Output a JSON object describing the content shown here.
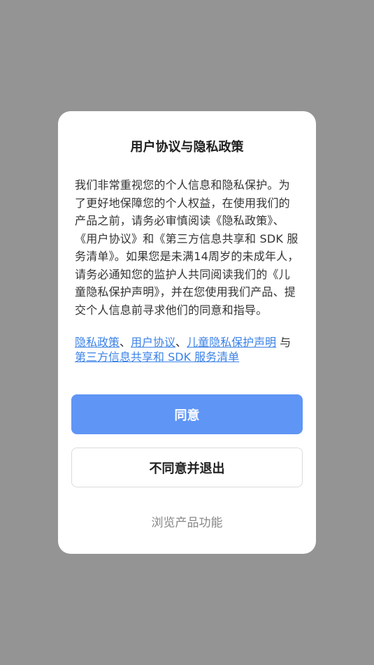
{
  "dialog": {
    "title": "用户协议与隐私政策",
    "body": "我们非常重视您的个人信息和隐私保护。为了更好地保障您的个人权益，在使用我们的产品之前，请务必审慎阅读《隐私政策》、《用户协议》和《第三方信息共享和 SDK 服务清单》。如果您是未满14周岁的未成年人，请务必通知您的监护人共同阅读我们的《儿童隐私保护声明》，并在您使用我们产品、提交个人信息前寻求他们的同意和指导。",
    "links": {
      "privacy_policy": "隐私政策",
      "sep1": "、",
      "user_agreement": "用户协议",
      "sep2": "、",
      "child_privacy": "儿童隐私保护声明",
      "and": " 与",
      "third_party_sdk": "第三方信息共享和 SDK 服务清单"
    },
    "agree_label": "同意",
    "disagree_label": "不同意并退出",
    "browse_label": "浏览产品功能"
  },
  "colors": {
    "backdrop": "#949494",
    "accent": "#5f95f5",
    "link": "#3b82e6"
  }
}
